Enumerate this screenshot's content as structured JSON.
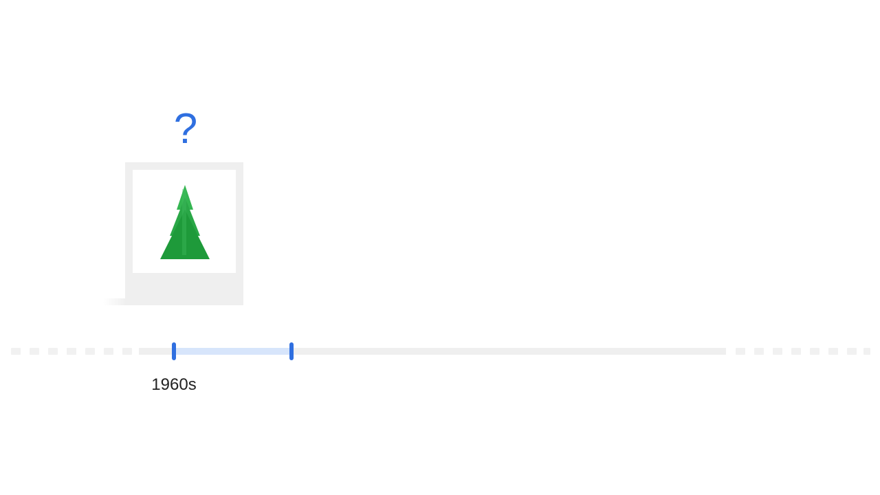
{
  "mystery_card": {
    "question_mark": "?",
    "icon": "pine-tree-icon"
  },
  "timeline": {
    "selected_decade": "1960s",
    "handles": [
      "range-start-handle",
      "range-end-handle"
    ]
  },
  "colors": {
    "accent_blue": "#2f6fe0",
    "range_fill": "#d7e5fb",
    "tree_green_dark": "#1e9a3a",
    "tree_green_light": "#34b551",
    "track_gray": "#efefef",
    "card_gray": "#efefef",
    "label_text": "#222222"
  }
}
